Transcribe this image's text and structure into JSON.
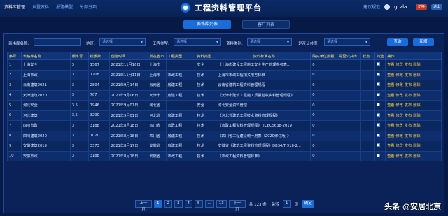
{
  "nav": [
    "资料库管理",
    "从登资料",
    "报警模型",
    "分部分项"
  ],
  "app_title": "工程资料管理平台",
  "user": {
    "label": "建议规范",
    "name": "gczla...",
    "btn1": "切换",
    "btn2": "退出"
  },
  "tabs": [
    "表格库列表",
    "客户列表"
  ],
  "filters": {
    "name_label": "表格库名称:",
    "region_label": "地区:",
    "region_value": "请选择",
    "engtype_label": "工程类型:",
    "engtype_value": "请选择",
    "datatype_label": "资料类别:",
    "datatype_value": "请选择",
    "public_label": "是否公共库:",
    "public_value": "请选择",
    "query": "查询",
    "add": "新增"
  },
  "table": {
    "headers": [
      "序号",
      "表格库名称",
      "版本号",
      "模板数",
      "创建时间",
      "所在省市",
      "工程类型",
      "资料类型",
      "资料标准名称",
      "购买单位数量",
      "是否公共库",
      "状态",
      "勾选",
      "操作"
    ],
    "rows": [
      [
        "1",
        "上海安全",
        "3",
        "1567",
        "2021年11月16日",
        "上海市",
        "",
        "安全",
        "《上海市建设工程施工安全生产管理参考表...",
        "0"
      ],
      [
        "2",
        "上海市政",
        "3",
        "1708",
        "2021年11月11日",
        "上海市",
        "市政工程",
        "技术",
        "上海市市政工程相关地方标准",
        "0"
      ],
      [
        "3",
        "云南建筑2021",
        "3",
        "2804",
        "2021年9月14日",
        "云南省",
        "房建工程",
        "技术",
        "云南省建筑工程资料管理规程",
        "0"
      ],
      [
        "4",
        "天津建筑2020",
        "3",
        "707",
        "2021年9月06日",
        "天津市",
        "房建工程",
        "技术",
        "《天津市建筑工程施工质量验收资料管理规程》",
        "0"
      ],
      [
        "5",
        "河北安全",
        "3.5",
        "1946",
        "2021年9月01日",
        "河北省",
        "",
        "安全",
        "河北安全资料管理",
        "0"
      ],
      [
        "6",
        "河北建筑",
        "3.5",
        "3290",
        "2021年9月01日",
        "河北省",
        "房建工程",
        "技术",
        "《河北省建筑工程技术资料管理规程》",
        "0"
      ],
      [
        "7",
        "四川市政",
        "3",
        "3188",
        "2021年8月18日",
        "四川省",
        "市政工程",
        "技术",
        "《市政工程资料管理规程》 TCECS638-2019",
        "0"
      ],
      [
        "8",
        "四川建筑2020",
        "3",
        "1020",
        "2021年8月18日",
        "四川省",
        "房建工程",
        "技术",
        "《四川省工程建设统一用表（2020修订版）》",
        "0"
      ],
      [
        "9",
        "安徽建筑2019",
        "3",
        "3373",
        "2021年8月17日",
        "安徽省",
        "房建工程",
        "技术",
        "安徽省《建筑工程资料管理规程》DB34/T 918-2...",
        "0"
      ],
      [
        "10",
        "安徽市政",
        "3",
        "3188",
        "2021年8月18日",
        "安徽省",
        "市政工程",
        "技术",
        "《市政工程资料管理标准》",
        "0"
      ]
    ],
    "ops": [
      "查看",
      "修改",
      "发布",
      "删除"
    ]
  },
  "pager": {
    "prev": "上一页",
    "pages": [
      "1",
      "2",
      "3",
      "4",
      "5",
      "...",
      "13"
    ],
    "next": "下一页",
    "total": "共 123 条",
    "goto": "跳转",
    "page_value": "1",
    "page_unit": "页",
    "confirm": "确定"
  },
  "watermark": "头条 @安居北京"
}
